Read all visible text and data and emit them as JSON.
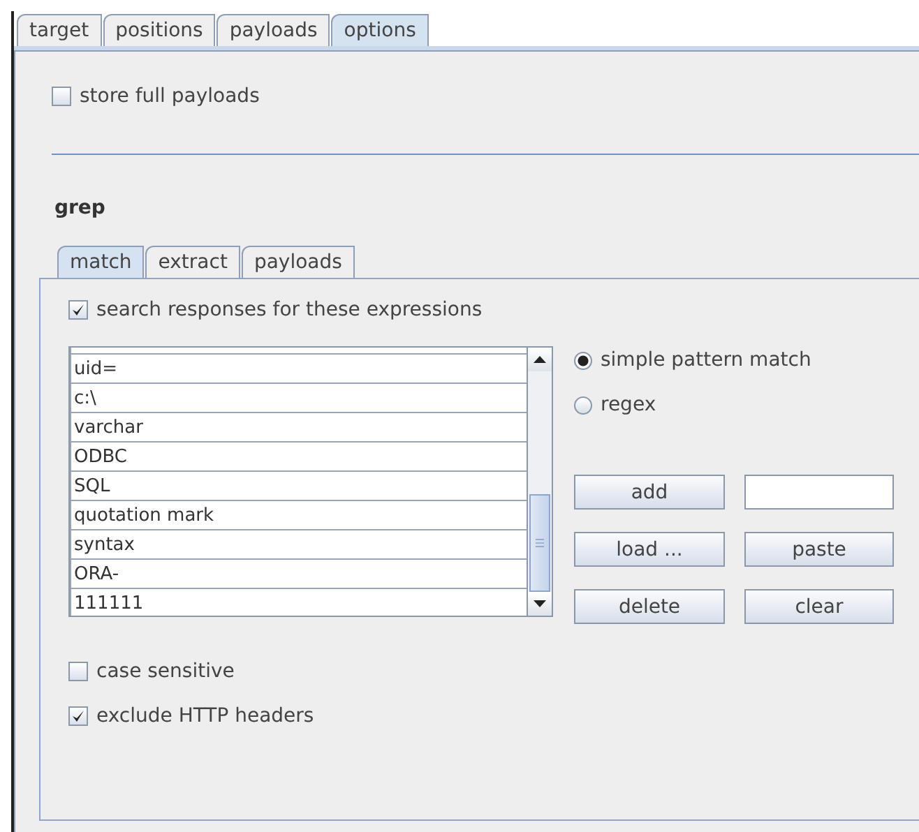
{
  "tabs": [
    {
      "label": "target",
      "selected": false
    },
    {
      "label": "positions",
      "selected": false
    },
    {
      "label": "payloads",
      "selected": false
    },
    {
      "label": "options",
      "selected": true
    }
  ],
  "store_full_payloads": {
    "label": "store full payloads",
    "checked": false
  },
  "grep": {
    "title": "grep",
    "tabs": [
      {
        "label": "match",
        "selected": true
      },
      {
        "label": "extract",
        "selected": false
      },
      {
        "label": "payloads",
        "selected": false
      }
    ],
    "search_responses": {
      "label": "search responses for these expressions",
      "checked": true
    },
    "expressions": [
      "uid=",
      "c:\\",
      "varchar",
      "ODBC",
      "SQL",
      "quotation mark",
      "syntax",
      "ORA-",
      "111111"
    ],
    "match_modes": [
      {
        "label": "simple pattern match",
        "selected": true
      },
      {
        "label": "regex",
        "selected": false
      }
    ],
    "buttons": {
      "add": "add",
      "load": "load ...",
      "paste": "paste",
      "delete": "delete",
      "clear": "clear"
    },
    "options": [
      {
        "label": "case sensitive",
        "checked": false
      },
      {
        "label": "exclude HTTP headers",
        "checked": true
      }
    ]
  }
}
